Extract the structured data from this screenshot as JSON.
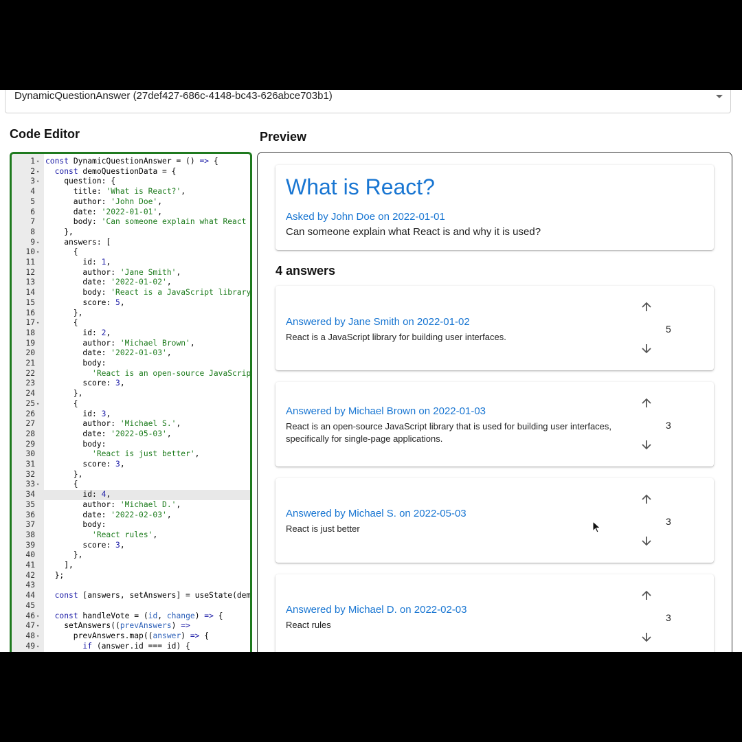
{
  "selector": {
    "value": "DynamicQuestionAnswer (27def427-686c-4148-bc43-626abce703b1)"
  },
  "editor": {
    "title": "Code Editor"
  },
  "preview": {
    "title": "Preview",
    "question": {
      "title": "What is React?",
      "meta": "Asked by John Doe on 2022-01-01",
      "body": "Can someone explain what React is and why it is used?"
    },
    "answers_count": "4 answers",
    "answers": [
      {
        "meta": "Answered by Jane Smith on 2022-01-02",
        "body": "React is a JavaScript library for building user interfaces.",
        "score": "5"
      },
      {
        "meta": "Answered by Michael Brown on 2022-01-03",
        "body": "React is an open-source JavaScript library that is used for building user interfaces, specifically for single-page applications.",
        "score": "3"
      },
      {
        "meta": "Answered by Michael S. on 2022-05-03",
        "body": "React is just better",
        "score": "3"
      },
      {
        "meta": "Answered by Michael D. on 2022-02-03",
        "body": "React rules",
        "score": "3"
      }
    ]
  },
  "code": {
    "lines": [
      [
        1,
        "f",
        "<span class=\"kw\">const</span> DynamicQuestionAnswer = () <span class=\"kw\">=></span> {"
      ],
      [
        2,
        "f",
        "  <span class=\"kw\">const</span> demoQuestionData = {"
      ],
      [
        3,
        "f",
        "    question: {"
      ],
      [
        4,
        "",
        "      title: <span class=\"str\">'What is React?'</span>,"
      ],
      [
        5,
        "",
        "      author: <span class=\"str\">'John Doe'</span>,"
      ],
      [
        6,
        "",
        "      date: <span class=\"str\">'2022-01-01'</span>,"
      ],
      [
        7,
        "",
        "      body: <span class=\"str\">'Can someone explain what React is</span>"
      ],
      [
        8,
        "",
        "    },"
      ],
      [
        9,
        "f",
        "    answers: ["
      ],
      [
        10,
        "f",
        "      {"
      ],
      [
        11,
        "",
        "        id: <span class=\"num\">1</span>,"
      ],
      [
        12,
        "",
        "        author: <span class=\"str\">'Jane Smith'</span>,"
      ],
      [
        13,
        "",
        "        date: <span class=\"str\">'2022-01-02'</span>,"
      ],
      [
        14,
        "",
        "        body: <span class=\"str\">'React is a JavaScript library fo</span>"
      ],
      [
        15,
        "",
        "        score: <span class=\"num\">5</span>,"
      ],
      [
        16,
        "",
        "      },"
      ],
      [
        17,
        "f",
        "      {"
      ],
      [
        18,
        "",
        "        id: <span class=\"num\">2</span>,"
      ],
      [
        19,
        "",
        "        author: <span class=\"str\">'Michael Brown'</span>,"
      ],
      [
        20,
        "",
        "        date: <span class=\"str\">'2022-01-03'</span>,"
      ],
      [
        21,
        "",
        "        body:"
      ],
      [
        22,
        "",
        "          <span class=\"str\">'React is an open-source JavaScript</span>"
      ],
      [
        23,
        "",
        "        score: <span class=\"num\">3</span>,"
      ],
      [
        24,
        "",
        "      },"
      ],
      [
        25,
        "f",
        "      {"
      ],
      [
        26,
        "",
        "        id: <span class=\"num\">3</span>,"
      ],
      [
        27,
        "",
        "        author: <span class=\"str\">'Michael S.'</span>,"
      ],
      [
        28,
        "",
        "        date: <span class=\"str\">'2022-05-03'</span>,"
      ],
      [
        29,
        "",
        "        body:"
      ],
      [
        30,
        "",
        "          <span class=\"str\">'React is just better'</span>,"
      ],
      [
        31,
        "",
        "        score: <span class=\"num\">3</span>,"
      ],
      [
        32,
        "",
        "      },"
      ],
      [
        33,
        "f",
        "      {"
      ],
      [
        34,
        "a",
        "        id: <span class=\"num\">4</span>,"
      ],
      [
        35,
        "",
        "        author: <span class=\"str\">'Michael D.'</span>,"
      ],
      [
        36,
        "",
        "        date: <span class=\"str\">'2022-02-03'</span>,"
      ],
      [
        37,
        "",
        "        body:"
      ],
      [
        38,
        "",
        "          <span class=\"str\">'React rules'</span>,"
      ],
      [
        39,
        "",
        "        score: <span class=\"num\">3</span>,"
      ],
      [
        40,
        "",
        "      },"
      ],
      [
        41,
        "",
        "    ],"
      ],
      [
        42,
        "",
        "  };"
      ],
      [
        43,
        "",
        ""
      ],
      [
        44,
        "",
        "  <span class=\"kw\">const</span> [answers, setAnswers] = useState(demo"
      ],
      [
        45,
        "",
        ""
      ],
      [
        46,
        "f",
        "  <span class=\"kw\">const</span> handleVote = (<span class=\"prm\">id</span>, <span class=\"prm\">change</span>) <span class=\"kw\">=></span> {"
      ],
      [
        47,
        "f",
        "    setAnswers((<span class=\"prm\">prevAnswers</span>) <span class=\"kw\">=></span>"
      ],
      [
        48,
        "f",
        "      prevAnswers.map((<span class=\"prm\">answer</span>) <span class=\"kw\">=></span> {"
      ],
      [
        49,
        "f",
        "        <span class=\"kw\">if</span> (answer.id === id) {"
      ]
    ]
  }
}
